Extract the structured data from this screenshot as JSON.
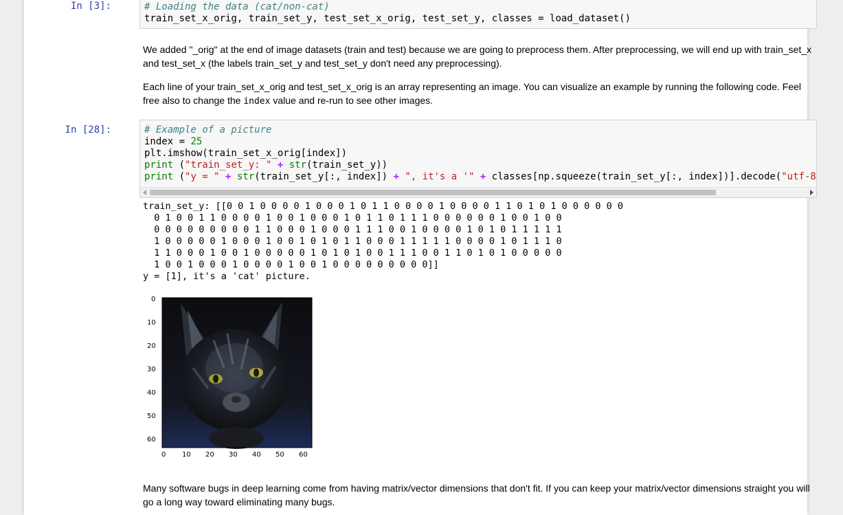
{
  "cells": {
    "load": {
      "prompt": "In [3]:",
      "comment": "# Loading the data (cat/non-cat)",
      "code": "train_set_x_orig, train_set_y, test_set_x_orig, test_set_y, classes = load_dataset()"
    },
    "md1": {
      "p1": "We added \"_orig\" at the end of image datasets (train and test) because we are going to preprocess them. After preprocessing, we will end up with train_set_x and test_set_x (the labels train_set_y and test_set_y don't need any preprocessing).",
      "p2_a": "Each line of your train_set_x_orig and test_set_x_orig is an array representing an image. You can visualize an example by running the following code. Feel free also to change the ",
      "p2_code": "index",
      "p2_b": " value and re-run to see other images."
    },
    "example": {
      "prompt": "In [28]:",
      "comment": "# Example of a picture",
      "l2_a": "index ",
      "l2_op": "=",
      "l2_num": " 25",
      "l3": "plt.imshow(train_set_x_orig[index])",
      "l4_kw": "print",
      "l4_a": " (",
      "l4_str": "\"train_set_y: \"",
      "l4_op": " + ",
      "l4_fn": "str",
      "l4_b": "(train_set_y))",
      "l5_kw": "print",
      "l5_a": " (",
      "l5_str1": "\"y = \"",
      "l5_op1": " + ",
      "l5_fn": "str",
      "l5_b": "(train_set_y[:, index]) ",
      "l5_op2": "+",
      "l5_str2": " \", it's a '\"",
      "l5_op3": " + ",
      "l5_c": "classes[np.squeeze(train_set_y[:, index])].decode(",
      "l5_str3": "\"utf-8"
    },
    "output": {
      "lines": [
        "train_set_y: [[0 0 1 0 0 0 0 1 0 0 0 1 0 1 1 0 0 0 0 1 0 0 0 0 1 1 0 1 0 1 0 0 0 0 0 0",
        "  0 1 0 0 1 1 0 0 0 0 1 0 0 1 0 0 0 1 0 1 1 0 1 1 1 0 0 0 0 0 0 1 0 0 1 0 0",
        "  0 0 0 0 0 0 0 0 0 1 1 0 0 0 1 0 0 0 1 1 1 0 0 1 0 0 0 0 1 0 1 0 1 1 1 1 1",
        "  1 0 0 0 0 0 1 0 0 0 1 0 0 1 0 1 0 1 1 0 0 0 1 1 1 1 1 0 0 0 0 1 0 1 1 1 0",
        "  1 1 0 0 0 1 0 0 1 0 0 0 0 0 1 0 1 0 1 0 0 1 1 1 0 0 1 1 0 1 0 1 0 0 0 0 0",
        "  1 0 0 1 0 0 0 1 0 0 0 0 1 0 0 1 0 0 0 0 0 0 0 0 0]]",
        "y = [1], it's a 'cat' picture."
      ]
    },
    "plot": {
      "y_ticks": [
        "0",
        "10",
        "20",
        "30",
        "40",
        "50",
        "60"
      ],
      "x_ticks": [
        "0",
        "10",
        "20",
        "30",
        "40",
        "50",
        "60"
      ]
    },
    "md2": {
      "p1": "Many software bugs in deep learning come from having matrix/vector dimensions that don't fit. If you can keep your matrix/vector dimensions straight you will go a long way toward eliminating many bugs."
    }
  },
  "colors": {
    "prompt": "#303f9f",
    "code_bg": "#f7f7f7",
    "comment": "#408080",
    "string": "#BA2121",
    "keyword": "#008000"
  }
}
